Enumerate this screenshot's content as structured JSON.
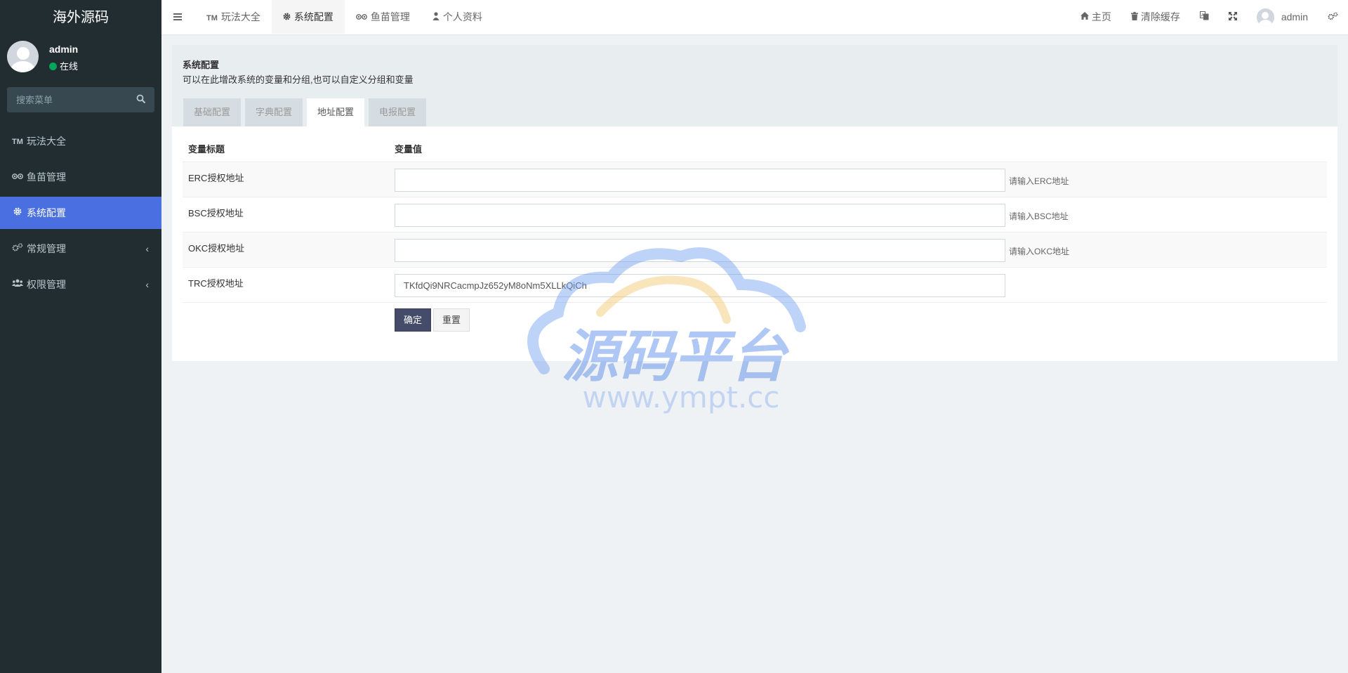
{
  "sidebar": {
    "logo": "海外源码",
    "user": {
      "name": "admin",
      "status": "在线"
    },
    "search_placeholder": "搜索菜单",
    "items": [
      {
        "icon": "TM",
        "label": "玩法大全",
        "active": false
      },
      {
        "icon": "glasses-icon",
        "label": "鱼苗管理",
        "active": false
      },
      {
        "icon": "gear-icon",
        "label": "系统配置",
        "active": true
      },
      {
        "icon": "gears-icon",
        "label": "常规管理",
        "active": false,
        "has_children": true
      },
      {
        "icon": "users-icon",
        "label": "权限管理",
        "active": false,
        "has_children": true
      }
    ],
    "chevron": "‹"
  },
  "topbar": {
    "tabs": [
      {
        "icon": "TM",
        "label": "玩法大全"
      },
      {
        "icon": "gear-icon",
        "label": "系统配置",
        "active": true
      },
      {
        "icon": "glasses-icon",
        "label": "鱼苗管理"
      },
      {
        "icon": "user-icon",
        "label": "个人资料"
      }
    ],
    "right": {
      "home": "主页",
      "clear_cache": "清除缓存",
      "username": "admin"
    }
  },
  "panel": {
    "title": "系统配置",
    "description": "可以在此增改系统的变量和分组,也可以自定义分组和变量",
    "tabs": [
      "基础配置",
      "字典配置",
      "地址配置",
      "电报配置"
    ],
    "active_tab": 2,
    "table": {
      "headers": [
        "变量标题",
        "变量值"
      ],
      "rows": [
        {
          "label": "ERC授权地址",
          "value": "",
          "tip": "请输入ERC地址"
        },
        {
          "label": "BSC授权地址",
          "value": "",
          "tip": "请输入BSC地址"
        },
        {
          "label": "OKC授权地址",
          "value": "",
          "tip": "请输入OKC地址"
        },
        {
          "label": "TRC授权地址",
          "value": "TKfdQi9NRCacmpJz652yM8oNm5XLLkQiCh",
          "tip": ""
        }
      ]
    },
    "buttons": {
      "submit": "确定",
      "reset": "重置"
    }
  },
  "watermark": {
    "title": "源码平台",
    "url": "www.ympt.cc"
  }
}
